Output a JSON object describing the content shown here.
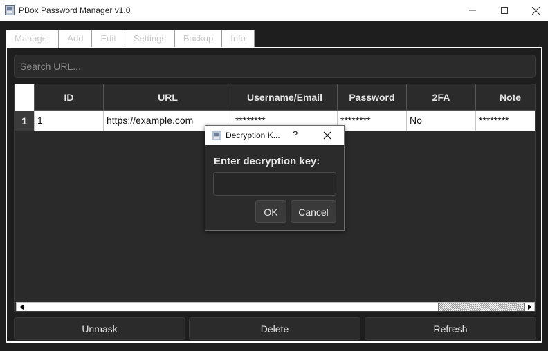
{
  "window": {
    "title": "PBox Password Manager v1.0",
    "icon": "app-icon",
    "controls": [
      "minimize-icon",
      "maximize-icon",
      "close-icon"
    ]
  },
  "tabs": [
    {
      "label": "Manager",
      "active": true
    },
    {
      "label": "Add"
    },
    {
      "label": "Edit"
    },
    {
      "label": "Settings"
    },
    {
      "label": "Backup"
    },
    {
      "label": "Info"
    }
  ],
  "search": {
    "placeholder": "Search URL..."
  },
  "table": {
    "columns": [
      "ID",
      "URL",
      "Username/Email",
      "Password",
      "2FA",
      "Note"
    ],
    "rows": [
      {
        "row_header": "1",
        "cells": [
          "1",
          "https://example.com",
          "********",
          "********",
          "No",
          "********"
        ]
      }
    ]
  },
  "buttons": {
    "unmask": "Unmask",
    "delete": "Delete",
    "refresh": "Refresh"
  },
  "dialog": {
    "title": "Decryption K...",
    "help": "?",
    "prompt": "Enter decryption key:",
    "input_value": "",
    "ok": "OK",
    "cancel": "Cancel"
  },
  "colors": {
    "background": "#1e1e1e",
    "surface": "#2b2b2b",
    "text": "#e6e6e6",
    "placeholder": "#8a8a8a"
  }
}
